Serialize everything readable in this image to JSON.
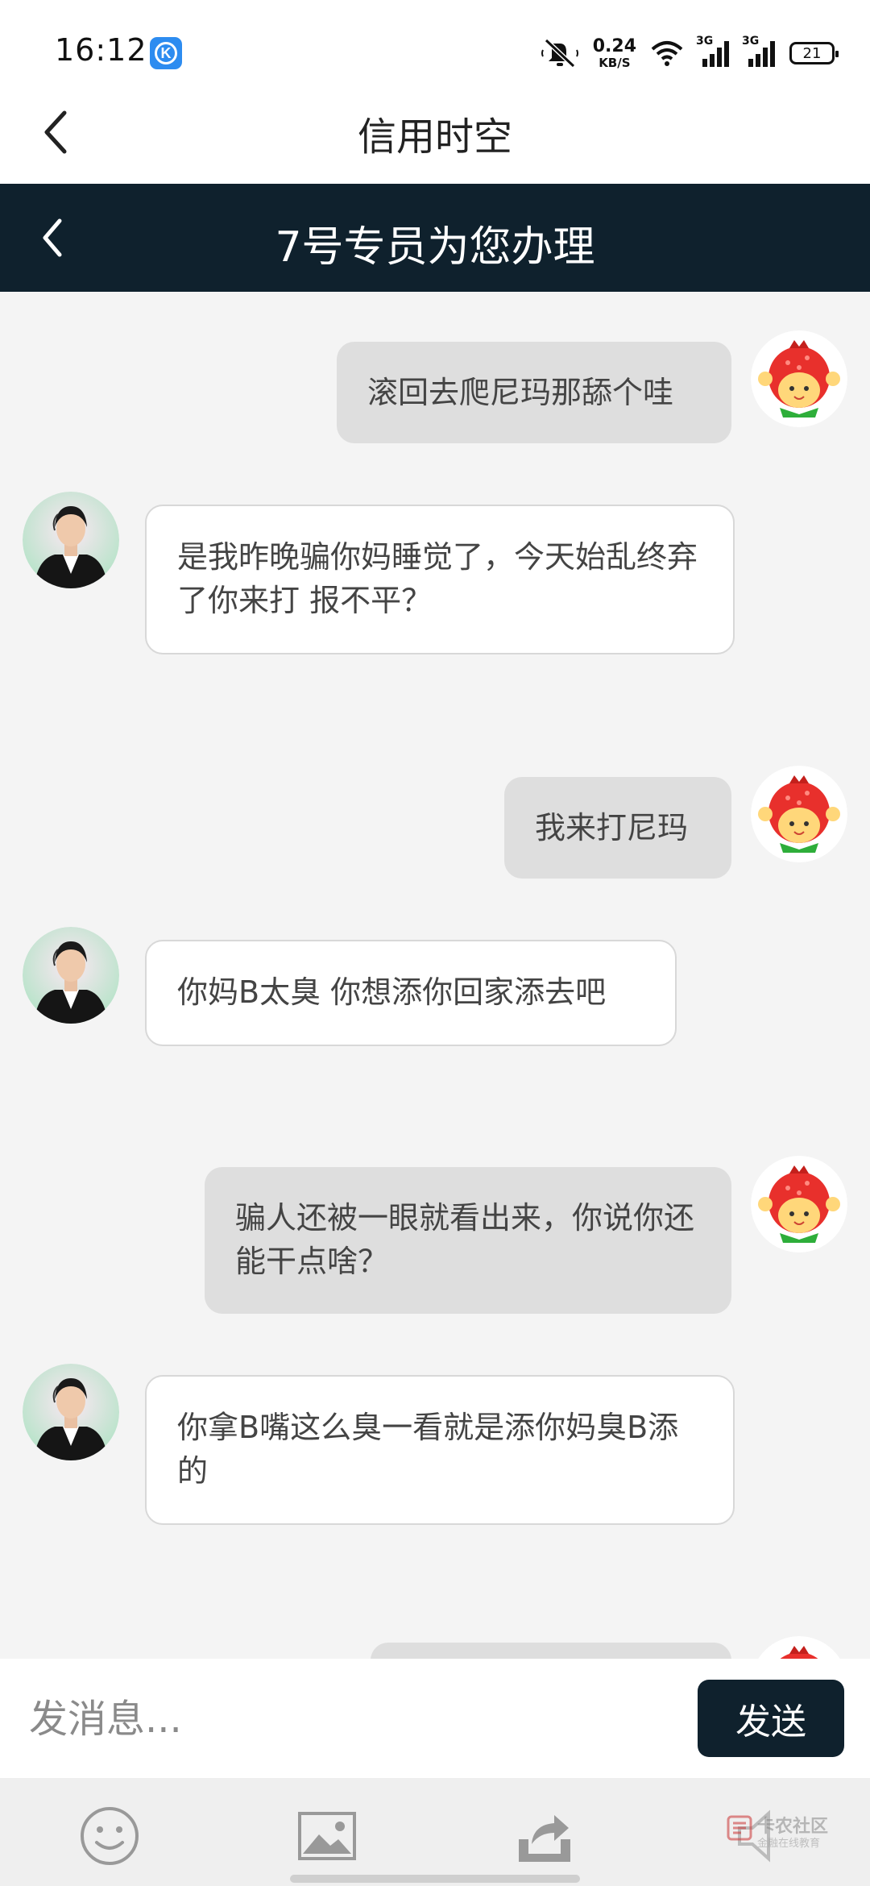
{
  "status_bar": {
    "time": "16:12",
    "app_icon": "k-app-icon",
    "speed_value": "0.24",
    "speed_unit": "KB/S",
    "signal1_label": "3G",
    "signal2_label": "3G",
    "battery": "21",
    "icons": [
      "mute-icon",
      "wifi-icon",
      "signal-icon",
      "battery-icon"
    ]
  },
  "title_bar": {
    "title": "信用时空"
  },
  "chat_header": {
    "title": "7号专员为您办理"
  },
  "messages": [
    {
      "side": "out",
      "text": "滚回去爬尼玛那舔个哇"
    },
    {
      "side": "in",
      "text": "是我昨晚骗你妈睡觉了，今天始乱终弃了你来打 报不平？"
    },
    {
      "side": "out",
      "text": "我来打尼玛"
    },
    {
      "side": "in",
      "text": "你妈B太臭 你想添你回家添去吧"
    },
    {
      "side": "out",
      "text": "骗人还被一眼就看出来，你说你还能干点啥？"
    },
    {
      "side": "in",
      "text": "你拿B嘴这么臭一看就是添你妈臭B添的"
    }
  ],
  "input": {
    "placeholder": "发消息...",
    "value": "",
    "send_label": "发送"
  },
  "toolbar": {
    "items": [
      "emoji-icon",
      "image-icon",
      "share-icon",
      "voice-icon"
    ]
  },
  "watermark": {
    "title": "卡农社区",
    "subtitle": "金融在线教育"
  },
  "colors": {
    "header_dark": "#0f212d",
    "bubble_out": "#dedede",
    "bubble_in": "#ffffff",
    "chat_bg": "#f4f4f4"
  }
}
